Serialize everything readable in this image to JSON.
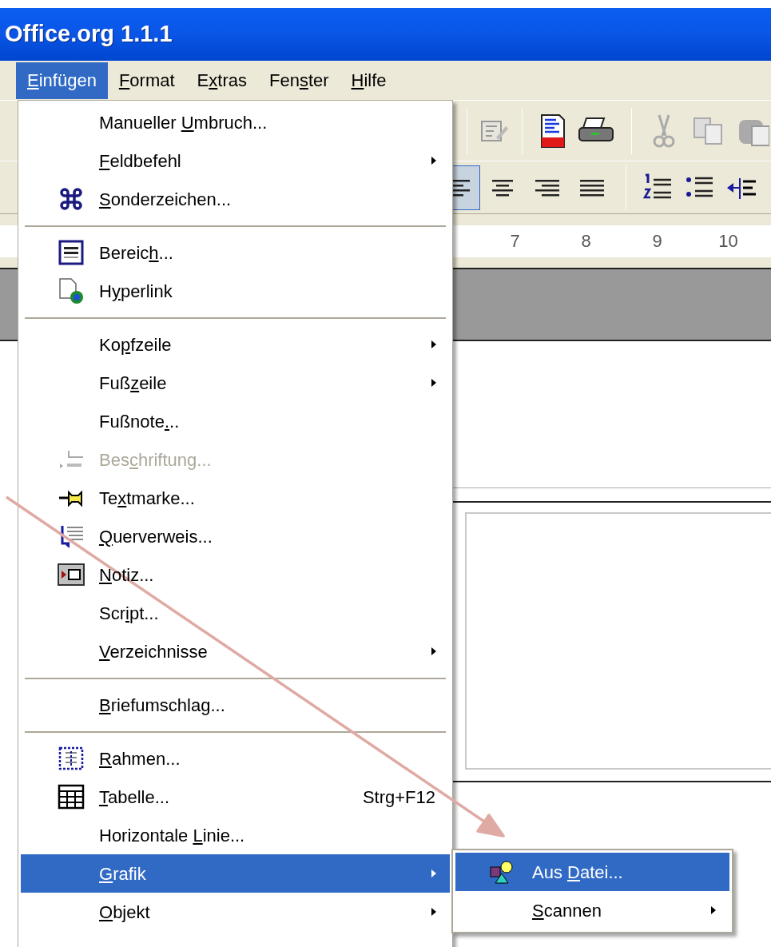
{
  "window": {
    "title": "Office.org 1.1.1"
  },
  "menubar": [
    {
      "parts": {
        "key": "E",
        "post": "infügen"
      },
      "selected": true
    },
    {
      "parts": {
        "key": "F",
        "post": "ormat"
      },
      "selected": false
    },
    {
      "parts": {
        "pre": "E",
        "key": "x",
        "post": "tras"
      },
      "selected": false
    },
    {
      "parts": {
        "pre": "Fen",
        "key": "s",
        "post": "ter"
      },
      "selected": false
    },
    {
      "parts": {
        "key": "H",
        "post": "ilfe"
      },
      "selected": false
    }
  ],
  "format_toolbar": [
    {
      "selected": true
    },
    {
      "selected": false
    },
    {
      "selected": false
    },
    {
      "selected": false
    }
  ],
  "ruler": [
    "7",
    "8",
    "9",
    "10"
  ],
  "menu": [
    {
      "kind": "item",
      "parts": {
        "pre": "Manueller ",
        "key": "U",
        "post": "mbruch..."
      },
      "submenu": false,
      "disabled": false,
      "selected": false
    },
    {
      "kind": "item",
      "parts": {
        "key": "F",
        "post": "eldbefehl"
      },
      "submenu": true,
      "disabled": false,
      "selected": false
    },
    {
      "kind": "item",
      "parts": {
        "key": "S",
        "post": "onderzeichen..."
      },
      "submenu": false,
      "disabled": false,
      "selected": false
    },
    {
      "kind": "separator"
    },
    {
      "kind": "item",
      "parts": {
        "pre": "Bereic",
        "key": "h",
        "post": "..."
      },
      "submenu": false,
      "disabled": false,
      "selected": false
    },
    {
      "kind": "item",
      "parts": {
        "pre": "H",
        "key": "y",
        "post": "perlink"
      },
      "submenu": false,
      "disabled": false,
      "selected": false
    },
    {
      "kind": "separator"
    },
    {
      "kind": "item",
      "parts": {
        "pre": "Ko",
        "key": "p",
        "post": "fzeile"
      },
      "submenu": true,
      "disabled": false,
      "selected": false
    },
    {
      "kind": "item",
      "parts": {
        "pre": "Fuß",
        "key": "z",
        "post": "eile"
      },
      "submenu": true,
      "disabled": false,
      "selected": false
    },
    {
      "kind": "item",
      "parts": {
        "pre": "Fußnote",
        "key": ".",
        "post": ".."
      },
      "submenu": false,
      "disabled": false,
      "selected": false
    },
    {
      "kind": "item",
      "parts": {
        "pre": "Bes",
        "key": "c",
        "post": "hriftung..."
      },
      "submenu": false,
      "disabled": true,
      "selected": false
    },
    {
      "kind": "item",
      "parts": {
        "pre": "Te",
        "key": "x",
        "post": "tmarke..."
      },
      "submenu": false,
      "disabled": false,
      "selected": false
    },
    {
      "kind": "item",
      "parts": {
        "key": "Q",
        "post": "uerverweis..."
      },
      "submenu": false,
      "disabled": false,
      "selected": false
    },
    {
      "kind": "item",
      "parts": {
        "key": "N",
        "post": "otiz..."
      },
      "submenu": false,
      "disabled": false,
      "selected": false
    },
    {
      "kind": "item",
      "parts": {
        "pre": "Scr",
        "key": "i",
        "post": "pt..."
      },
      "submenu": false,
      "disabled": false,
      "selected": false
    },
    {
      "kind": "item",
      "parts": {
        "key": "V",
        "post": "erzeichnisse"
      },
      "submenu": true,
      "disabled": false,
      "selected": false
    },
    {
      "kind": "separator"
    },
    {
      "kind": "item",
      "parts": {
        "key": "B",
        "post": "riefumschlag..."
      },
      "submenu": false,
      "disabled": false,
      "selected": false
    },
    {
      "kind": "separator"
    },
    {
      "kind": "item",
      "parts": {
        "key": "R",
        "post": "ahmen..."
      },
      "submenu": false,
      "disabled": false,
      "selected": false
    },
    {
      "kind": "item",
      "parts": {
        "key": "T",
        "post": "abelle..."
      },
      "shortcut": "Strg+F12",
      "submenu": false,
      "disabled": false,
      "selected": false
    },
    {
      "kind": "item",
      "parts": {
        "pre": "Horizontale ",
        "key": "L",
        "post": "inie..."
      },
      "submenu": false,
      "disabled": false,
      "selected": false
    },
    {
      "kind": "item",
      "parts": {
        "key": "G",
        "post": "rafik"
      },
      "submenu": true,
      "disabled": false,
      "selected": true
    },
    {
      "kind": "item",
      "parts": {
        "key": "O",
        "post": "bjekt"
      },
      "submenu": true,
      "disabled": false,
      "selected": false
    }
  ],
  "submenu": [
    {
      "parts": {
        "pre": "Aus ",
        "key": "D",
        "post": "atei..."
      },
      "submenu": false,
      "selected": true
    },
    {
      "parts": {
        "key": "S",
        "post": "cannen"
      },
      "submenu": true,
      "selected": false
    }
  ]
}
